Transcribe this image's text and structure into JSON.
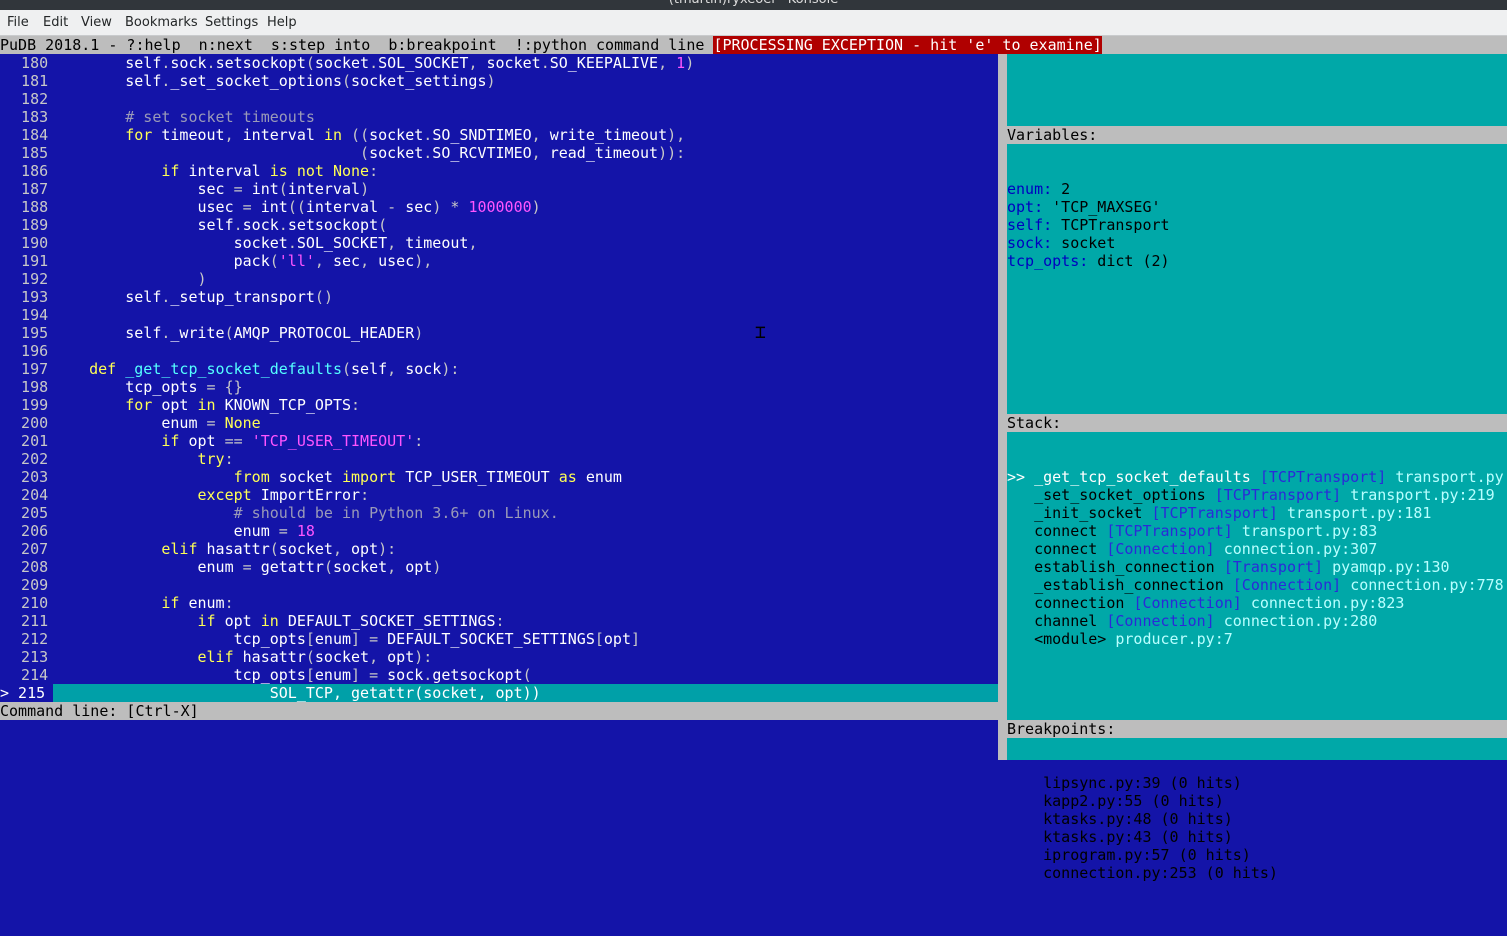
{
  "window": {
    "title": "(tmartin)ryxeoel - Konsole"
  },
  "menu": [
    "File",
    "Edit",
    "View",
    "Bookmarks",
    "Settings",
    "Help"
  ],
  "status": {
    "text": "PuDB 2018.1 - ?:help  n:next  s:step into  b:breakpoint  !:python command line ",
    "exception": "[PROCESSING EXCEPTION - hit 'e' to examine]"
  },
  "code": {
    "current_marker": "> ",
    "lines": [
      {
        "n": "180",
        "t": "        self.sock.setsockopt(socket.SOL_SOCKET, socket.SO_KEEPALIVE, 1)"
      },
      {
        "n": "181",
        "t": "        self._set_socket_options(socket_settings)"
      },
      {
        "n": "182",
        "t": ""
      },
      {
        "n": "183",
        "t": "        # set socket timeouts"
      },
      {
        "n": "184",
        "t": "        for timeout, interval in ((socket.SO_SNDTIMEO, write_timeout),"
      },
      {
        "n": "185",
        "t": "                                  (socket.SO_RCVTIMEO, read_timeout)):"
      },
      {
        "n": "186",
        "t": "            if interval is not None:"
      },
      {
        "n": "187",
        "t": "                sec = int(interval)"
      },
      {
        "n": "188",
        "t": "                usec = int((interval - sec) * 1000000)"
      },
      {
        "n": "189",
        "t": "                self.sock.setsockopt("
      },
      {
        "n": "190",
        "t": "                    socket.SOL_SOCKET, timeout,"
      },
      {
        "n": "191",
        "t": "                    pack('ll', sec, usec),"
      },
      {
        "n": "192",
        "t": "                )"
      },
      {
        "n": "193",
        "t": "        self._setup_transport()"
      },
      {
        "n": "194",
        "t": ""
      },
      {
        "n": "195",
        "t": "        self._write(AMQP_PROTOCOL_HEADER)"
      },
      {
        "n": "196",
        "t": ""
      },
      {
        "n": "197",
        "t": "    def _get_tcp_socket_defaults(self, sock):"
      },
      {
        "n": "198",
        "t": "        tcp_opts = {}"
      },
      {
        "n": "199",
        "t": "        for opt in KNOWN_TCP_OPTS:"
      },
      {
        "n": "200",
        "t": "            enum = None"
      },
      {
        "n": "201",
        "t": "            if opt == 'TCP_USER_TIMEOUT':"
      },
      {
        "n": "202",
        "t": "                try:"
      },
      {
        "n": "203",
        "t": "                    from socket import TCP_USER_TIMEOUT as enum"
      },
      {
        "n": "204",
        "t": "                except ImportError:"
      },
      {
        "n": "205",
        "t": "                    # should be in Python 3.6+ on Linux."
      },
      {
        "n": "206",
        "t": "                    enum = 18"
      },
      {
        "n": "207",
        "t": "            elif hasattr(socket, opt):"
      },
      {
        "n": "208",
        "t": "                enum = getattr(socket, opt)"
      },
      {
        "n": "209",
        "t": ""
      },
      {
        "n": "210",
        "t": "            if enum:"
      },
      {
        "n": "211",
        "t": "                if opt in DEFAULT_SOCKET_SETTINGS:"
      },
      {
        "n": "212",
        "t": "                    tcp_opts[enum] = DEFAULT_SOCKET_SETTINGS[opt]"
      },
      {
        "n": "213",
        "t": "                elif hasattr(socket, opt):"
      },
      {
        "n": "214",
        "t": "                    tcp_opts[enum] = sock.getsockopt("
      },
      {
        "n": "215",
        "t": "                        SOL_TCP, getattr(socket, opt))",
        "current": true
      }
    ]
  },
  "command_line": {
    "label": "Command line: [Ctrl-X]"
  },
  "variables": {
    "header": "Variables:",
    "items": [
      {
        "name": "enum:",
        "value": " 2"
      },
      {
        "name": "opt:",
        "value": " 'TCP_MAXSEG'"
      },
      {
        "name": "self:",
        "value": " TCPTransport"
      },
      {
        "name": "sock:",
        "value": " socket"
      },
      {
        "name": "tcp_opts:",
        "value": " dict (2)"
      }
    ]
  },
  "stack": {
    "header": "Stack:",
    "items": [
      {
        "prefix": ">> ",
        "fn": "_get_tcp_socket_defaults",
        "cls": "[TCPTransport]",
        "file": "transport.py:",
        "selected": true
      },
      {
        "prefix": "   ",
        "fn": "_set_socket_options",
        "cls": "[TCPTransport]",
        "file": "transport.py:219"
      },
      {
        "prefix": "   ",
        "fn": "_init_socket",
        "cls": "[TCPTransport]",
        "file": "transport.py:181"
      },
      {
        "prefix": "   ",
        "fn": "connect",
        "cls": "[TCPTransport]",
        "file": "transport.py:83"
      },
      {
        "prefix": "   ",
        "fn": "connect",
        "cls": "[Connection]",
        "file": "connection.py:307"
      },
      {
        "prefix": "   ",
        "fn": "establish_connection",
        "cls": "[Transport]",
        "file": "pyamqp.py:130"
      },
      {
        "prefix": "   ",
        "fn": "_establish_connection",
        "cls": "[Connection]",
        "file": "connection.py:778"
      },
      {
        "prefix": "   ",
        "fn": "connection",
        "cls": "[Connection]",
        "file": "connection.py:823"
      },
      {
        "prefix": "   ",
        "fn": "channel",
        "cls": "[Connection]",
        "file": "connection.py:280"
      },
      {
        "prefix": "   ",
        "fn": "<module>",
        "cls": "",
        "file": "producer.py:7"
      }
    ]
  },
  "breakpoints": {
    "header": "Breakpoints:",
    "items": [
      "lipsync.py:39 (0 hits)",
      "kapp2.py:55 (0 hits)",
      "ktasks.py:48 (0 hits)",
      "ktasks.py:43 (0 hits)",
      "iprogram.py:57 (0 hits)",
      "connection.py:253 (0 hits)"
    ]
  },
  "colors": {
    "code_bg": "#1414a8",
    "side_bg": "#00a8a8",
    "status_bg": "#bdbdbd",
    "exception_bg": "#b00000",
    "keyword": "#ffff55",
    "string": "#ff55ff"
  }
}
